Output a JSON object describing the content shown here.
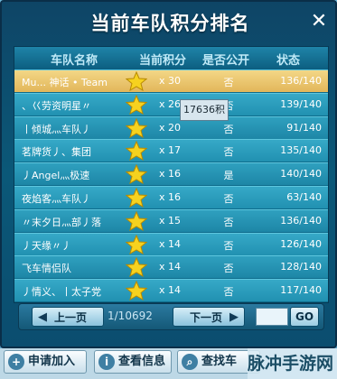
{
  "window": {
    "title": "当前车队积分排名"
  },
  "table": {
    "headers": {
      "name": "车队名称",
      "score": "当前积分",
      "public": "是否公开",
      "status": "状态"
    },
    "rows": [
      {
        "name": "Mu... 神话 • Team",
        "score": "x 30",
        "public": "否",
        "status": "136/140",
        "selected": true
      },
      {
        "name": "、巜劳资明星〃",
        "score": "x 26",
        "public": "否",
        "status": "139/140"
      },
      {
        "name": "丨倾城灬车队丿",
        "score": "x 20",
        "public": "否",
        "status": "91/140"
      },
      {
        "name": "茗牌货丿、集团",
        "score": "x 17",
        "public": "否",
        "status": "135/140"
      },
      {
        "name": "丿Angel灬极速",
        "score": "x 16",
        "public": "是",
        "status": "140/140"
      },
      {
        "name": "夜焰客灬车队丿",
        "score": "x 16",
        "public": "否",
        "status": "63/140"
      },
      {
        "name": "〃末夕日灬部丿落",
        "score": "x 15",
        "public": "否",
        "status": "136/140"
      },
      {
        "name": "丿天缘〃丿",
        "score": "x 14",
        "public": "否",
        "status": "126/140"
      },
      {
        "name": "飞车情侣队",
        "score": "x 14",
        "public": "否",
        "status": "128/140"
      },
      {
        "name": "丿情义、丨太子党",
        "score": "x 14",
        "public": "否",
        "status": "117/140"
      }
    ]
  },
  "tooltip": {
    "text": "17636积"
  },
  "pager": {
    "prev_label": "上一页",
    "next_label": "下一页",
    "page_info": "1/10692",
    "go_label": "GO"
  },
  "bottom": {
    "join_label": "申请加入",
    "view_label": "查看信息",
    "search_label": "查找车"
  },
  "watermark": "脉冲手游网",
  "colors": {
    "row": "#2fa0bf",
    "selected_row": "#e2b65a",
    "panel": "#0b5878",
    "star": "#f6d21f"
  }
}
